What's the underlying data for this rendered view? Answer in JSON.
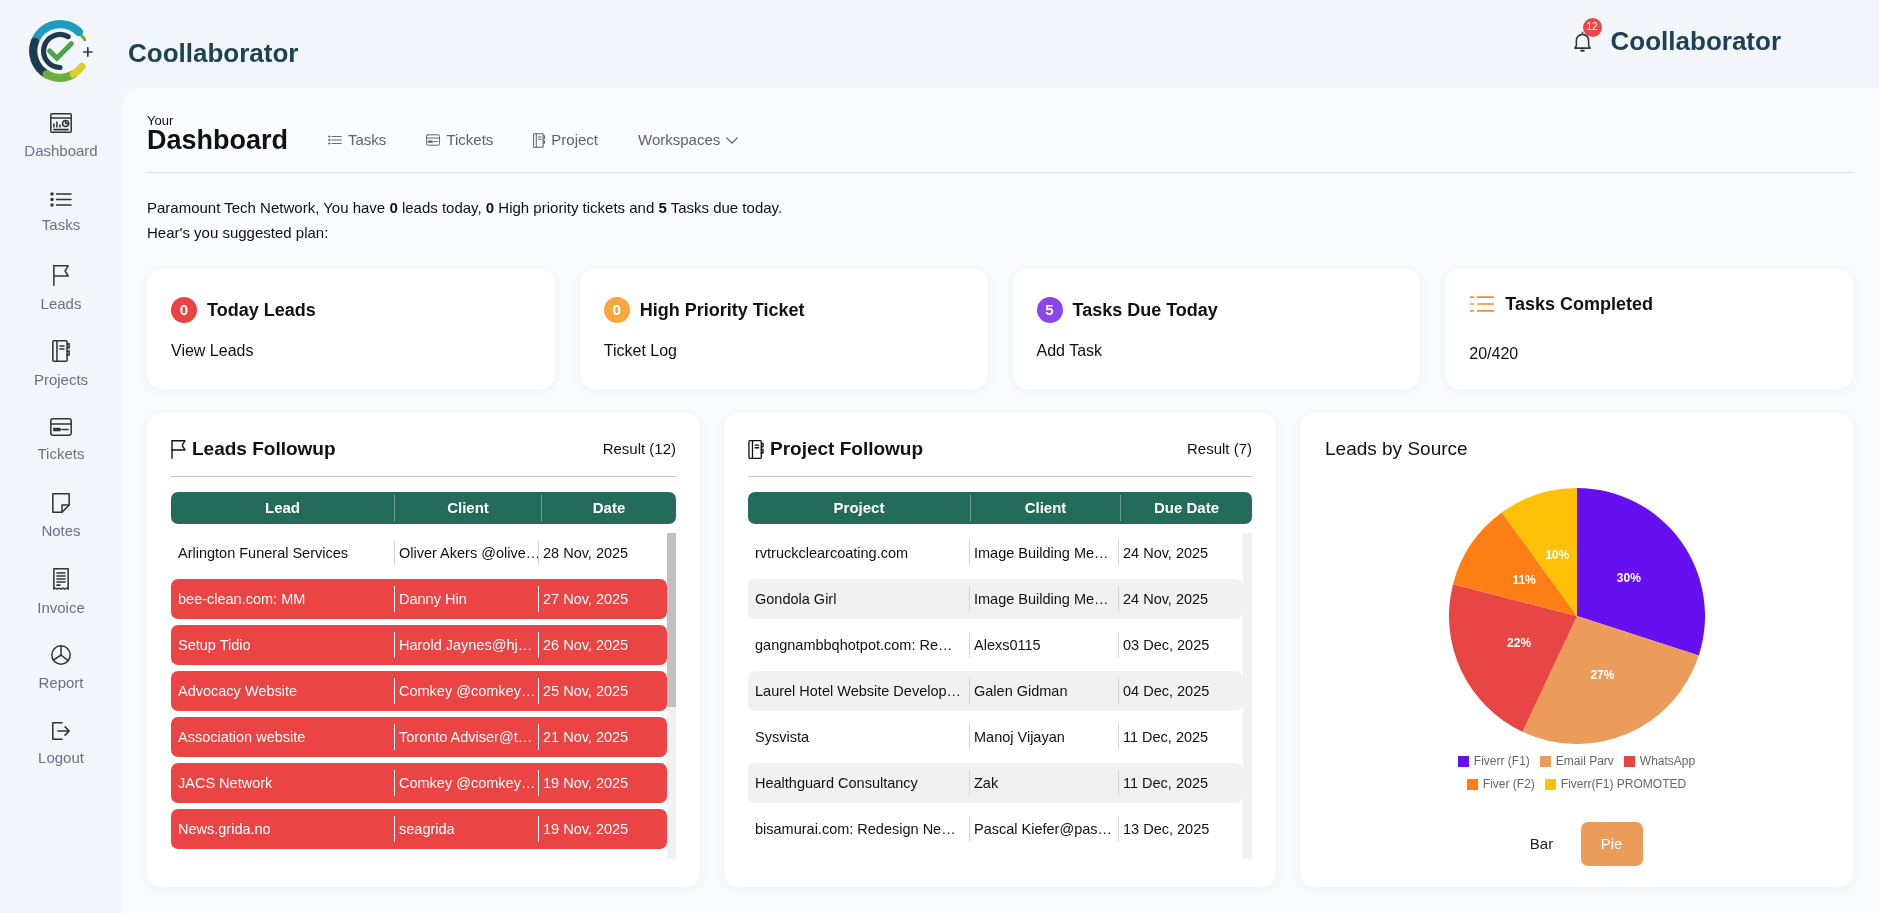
{
  "header": {
    "app_name": "Coollaborator",
    "notification_count": "12",
    "user_name": "Coollaborator"
  },
  "sidebar": {
    "items": [
      "Dashboard",
      "Tasks",
      "Leads",
      "Projects",
      "Tickets",
      "Notes",
      "Invoice",
      "Report",
      "Logout"
    ]
  },
  "dashboard": {
    "kicker": "Your",
    "title": "Dashboard",
    "tabs": [
      {
        "label": "Tasks",
        "dropdown": false
      },
      {
        "label": "Tickets",
        "dropdown": false
      },
      {
        "label": "Project",
        "dropdown": false
      },
      {
        "label": "Workspaces",
        "dropdown": true
      }
    ]
  },
  "greeting": [
    "Paramount Tech Network, You have **0** leads today, **0** High priority tickets and **5** Tasks due today.",
    "Hear's you suggested plan:"
  ],
  "summary_cards": [
    {
      "kind": "count",
      "count": "0",
      "color": "#ea4343",
      "title": "Today Leads",
      "link": "View Leads"
    },
    {
      "kind": "count",
      "count": "0",
      "color": "#f5a83e",
      "title": "High Priority Ticket",
      "link": "Ticket Log"
    },
    {
      "kind": "count",
      "count": "5",
      "color": "#8b46ee",
      "title": "Tasks Due Today",
      "link": "Add Task"
    },
    {
      "kind": "progress",
      "title": "Tasks Completed",
      "value": "20/420"
    }
  ],
  "leads_followup": {
    "title": "Leads Followup",
    "result": "Result (12)",
    "columns": [
      "Lead",
      "Client",
      "Date"
    ],
    "rows": [
      {
        "cells": [
          "Arlington Funeral Services",
          "Oliver Akers @olive…",
          "28 Nov, 2025"
        ],
        "highlighted": false
      },
      {
        "cells": [
          "bee-clean.com: MM",
          "Danny Hin",
          "27 Nov, 2025"
        ],
        "highlighted": true
      },
      {
        "cells": [
          "Setup Tidio",
          "Harold Jaynes@hj…",
          "26 Nov, 2025"
        ],
        "highlighted": true
      },
      {
        "cells": [
          "Advocacy Website",
          "Comkey @comkey…",
          "25 Nov, 2025"
        ],
        "highlighted": true
      },
      {
        "cells": [
          "Association website",
          "Toronto Adviser@t…",
          "21 Nov, 2025"
        ],
        "highlighted": true
      },
      {
        "cells": [
          "JACS Network",
          "Comkey @comkey…",
          "19 Nov, 2025"
        ],
        "highlighted": true
      },
      {
        "cells": [
          "News.grida.no",
          "seagrida",
          "19 Nov, 2025"
        ],
        "highlighted": true
      }
    ]
  },
  "project_followup": {
    "title": "Project Followup",
    "result": "Result (7)",
    "columns": [
      "Project",
      "Client",
      "Due Date"
    ],
    "rows": [
      {
        "cells": [
          "rvtruckclearcoating.com",
          "Image Building Me…",
          "24 Nov, 2025"
        ]
      },
      {
        "cells": [
          "Gondola Girl",
          "Image Building Me…",
          "24 Nov, 2025"
        ]
      },
      {
        "cells": [
          "gangnambbqhotpot.com: Re…",
          "Alexs0115",
          "03 Dec, 2025"
        ]
      },
      {
        "cells": [
          "Laurel Hotel Website Develop…",
          "Galen Gidman",
          "04 Dec, 2025"
        ]
      },
      {
        "cells": [
          "Sysvista",
          "Manoj Vijayan",
          "11 Dec, 2025"
        ]
      },
      {
        "cells": [
          "Healthguard Consultancy",
          "Zak",
          "11 Dec, 2025"
        ]
      },
      {
        "cells": [
          "bisamurai.com: Redesign Ne…",
          "Pascal Kiefer@pas…",
          "13 Dec, 2025"
        ]
      }
    ]
  },
  "leads_by_source": {
    "chart_data": {
      "type": "pie",
      "title": "Leads by Source",
      "categories": [
        "Fiverr (F1)",
        "Email Parv",
        "WhatsApp",
        "Fiver (F2)",
        "Fiverr(F1) PROMOTED"
      ],
      "values": [
        30,
        27,
        22,
        11,
        10
      ],
      "colors": [
        "#6610f2",
        "#eb9c5a",
        "#e84545",
        "#fd7e14",
        "#ffc107"
      ],
      "value_labels": [
        "30%",
        "27%",
        "22%",
        "11%",
        "10%"
      ]
    },
    "view_toggle": [
      {
        "label": "Bar",
        "selected": false
      },
      {
        "label": "Pie",
        "selected": true
      }
    ]
  }
}
